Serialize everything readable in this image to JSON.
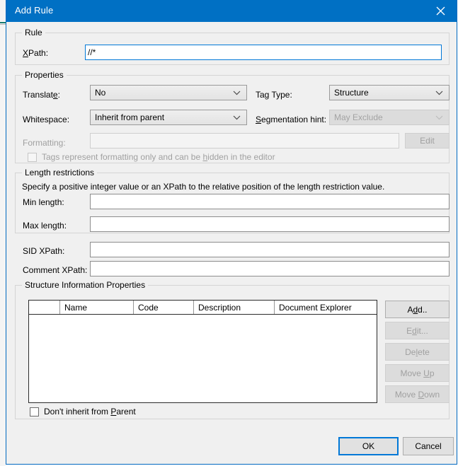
{
  "window": {
    "title": "Add Rule",
    "close_icon": "close-icon"
  },
  "rule_group": {
    "legend": "Rule",
    "xpath_label_pre": "X",
    "xpath_label_post": "Path:",
    "xpath_value": "//*"
  },
  "properties_group": {
    "legend": "Properties",
    "translate_label_pre": "Translat",
    "translate_label_acc": "e",
    "translate_label_post": ":",
    "translate_value": "No",
    "tag_type_label": "Tag Type:",
    "tag_type_value": "Structure",
    "whitespace_label": "Whitespace:",
    "whitespace_value": "Inherit from parent",
    "segmentation_label_pre": "",
    "segmentation_label_acc": "S",
    "segmentation_label_post": "egmentation hint:",
    "segmentation_value": "May Exclude",
    "formatting_label": "Formatting:",
    "formatting_value": "",
    "edit_button": "Edit",
    "formatting_checkbox_pre": "Tags represent formatting only and can be ",
    "formatting_checkbox_acc": "h",
    "formatting_checkbox_post": "idden in the editor"
  },
  "length_group": {
    "legend": "Length restrictions",
    "description": "Specify a positive integer value or an XPath to the relative position of the length restriction value.",
    "min_label": "Min length:",
    "min_value": "",
    "max_label": "Max length:",
    "max_value": ""
  },
  "xpath_fields": {
    "sid_label": "SID XPath:",
    "sid_value": "",
    "comment_label": "Comment XPath:",
    "comment_value": ""
  },
  "structure_group": {
    "legend": "Structure Information Properties",
    "columns": [
      "",
      "Name",
      "Code",
      "Description",
      "Document Explorer"
    ],
    "rows": [],
    "buttons": [
      {
        "label_pre": "A",
        "label_acc": "d",
        "label_post": "d..",
        "enabled": true
      },
      {
        "label_pre": "E",
        "label_acc": "d",
        "label_post": "it...",
        "enabled": false
      },
      {
        "label_pre": "De",
        "label_acc": "l",
        "label_post": "ete",
        "enabled": false
      },
      {
        "label_pre": "Move ",
        "label_acc": "U",
        "label_post": "p",
        "enabled": false
      },
      {
        "label_pre": "Move ",
        "label_acc": "D",
        "label_post": "own",
        "enabled": false
      }
    ],
    "inherit_checkbox_pre": "Don't inherit from ",
    "inherit_checkbox_acc": "P",
    "inherit_checkbox_post": "arent"
  },
  "footer": {
    "ok_label": "OK",
    "cancel_label": "Cancel"
  },
  "colors": {
    "title_bar": "#0070c4",
    "dialog_border": "#0069c0",
    "dialog_bg": "#f0f0f0",
    "focus_blue": "#0078d7",
    "disabled_text": "#a0a0a0"
  }
}
